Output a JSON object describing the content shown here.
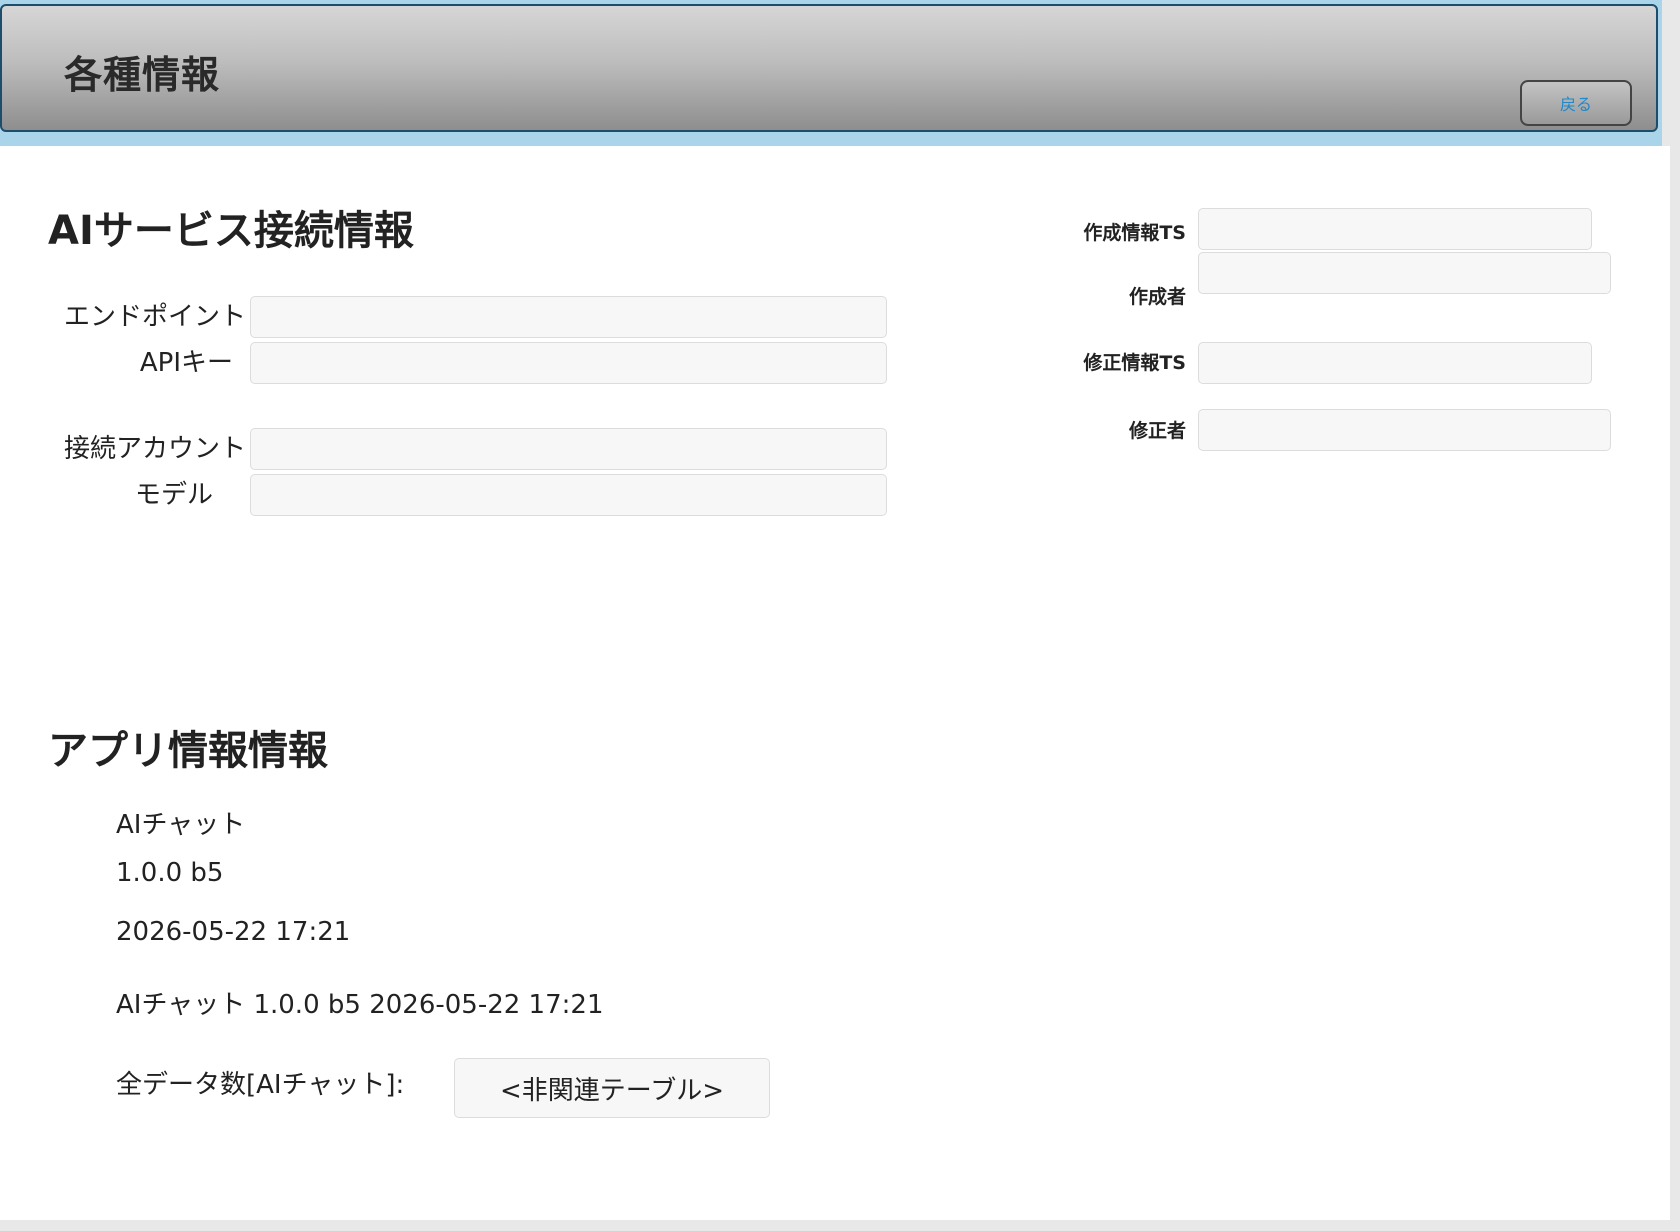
{
  "header": {
    "title": "各種情報",
    "back_label": "戻る"
  },
  "ai_service": {
    "title": "AIサービス接続情報",
    "fields": {
      "endpoint": {
        "label": "エンドポイント",
        "value": ""
      },
      "api_key": {
        "label": "APIキー",
        "value": ""
      },
      "account": {
        "label": "接続アカウント",
        "value": ""
      },
      "model": {
        "label": "モデル",
        "value": ""
      }
    }
  },
  "meta": {
    "created_ts": {
      "label": "作成情報TS",
      "value": ""
    },
    "creator": {
      "label": "作成者",
      "value": ""
    },
    "modified_ts": {
      "label": "修正情報TS",
      "value": ""
    },
    "modifier": {
      "label": "修正者",
      "value": ""
    }
  },
  "app_info": {
    "title": "アプリ情報情報",
    "app_name": "AIチャット",
    "version": "1.0.0 b5",
    "build_date": "2026-05-22 17:21",
    "summary": "AIチャット 1.0.0 b5 2026-05-22 17:21",
    "record_count_label": "全データ数[AIチャット]:",
    "record_count_value": "<非関連テーブル>"
  }
}
